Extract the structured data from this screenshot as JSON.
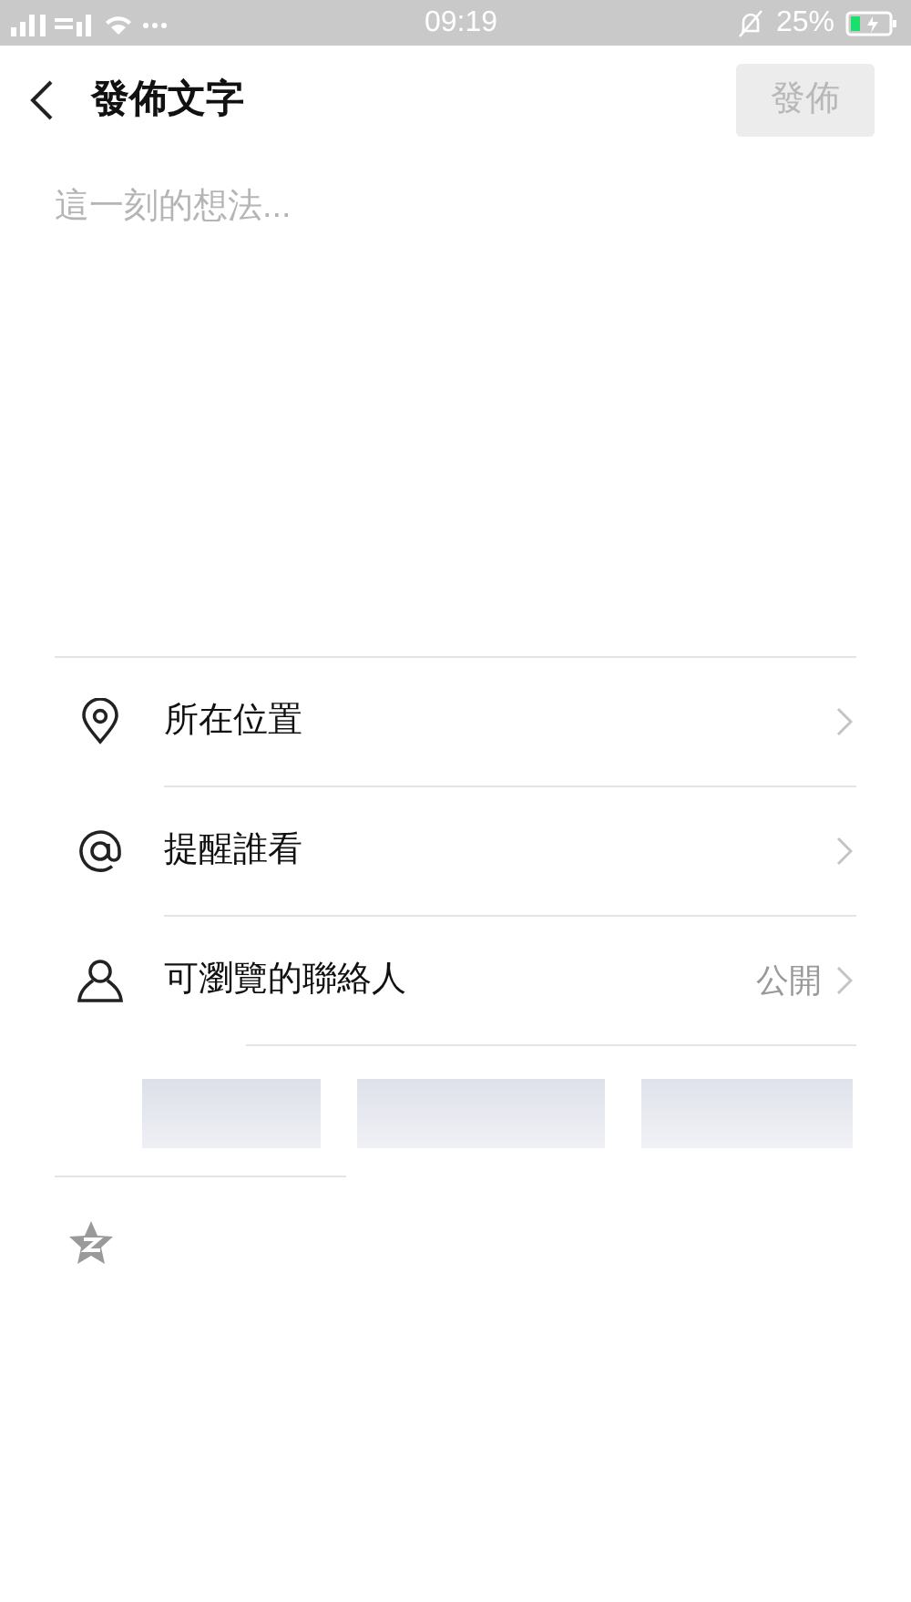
{
  "status_bar": {
    "time": "09:19",
    "battery": "25%"
  },
  "header": {
    "title": "發佈文字",
    "publish_button": {
      "label": "發佈",
      "disabled": true
    }
  },
  "post_field": {
    "placeholder": "這一刻的想法..."
  },
  "options": [
    {
      "kind": "location",
      "label": "所在位置"
    },
    {
      "kind": "mention",
      "label": "提醒誰看"
    },
    {
      "kind": "contacts",
      "label": "可瀏覽的聯絡人",
      "value": "公開"
    }
  ]
}
